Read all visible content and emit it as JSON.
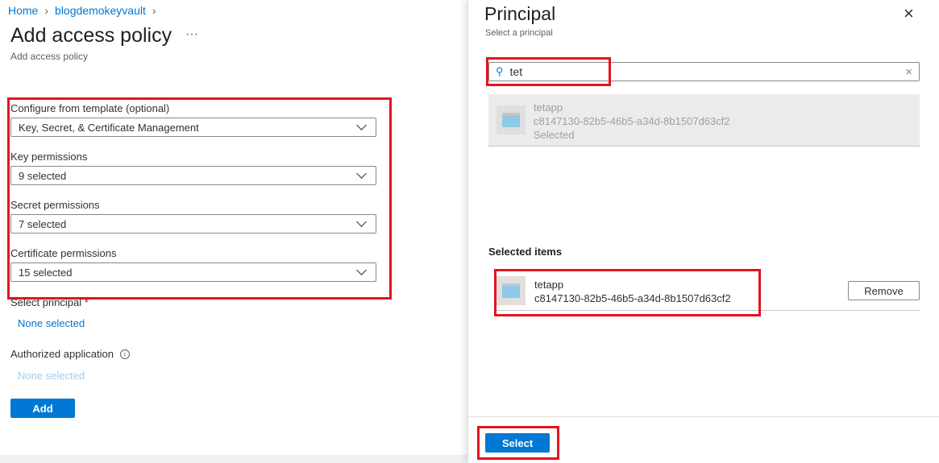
{
  "breadcrumb": {
    "home": "Home",
    "vault": "blogdemokeyvault"
  },
  "page": {
    "title": "Add access policy",
    "more": "···",
    "subtitle": "Add access policy"
  },
  "form": {
    "template": {
      "label": "Configure from template (optional)",
      "value": "Key, Secret, & Certificate Management"
    },
    "key": {
      "label": "Key permissions",
      "value": "9 selected"
    },
    "secret": {
      "label": "Secret permissions",
      "value": "7 selected"
    },
    "cert": {
      "label": "Certificate permissions",
      "value": "15 selected"
    },
    "principal": {
      "label": "Select principal",
      "required": "*",
      "value": "None selected"
    },
    "authapp": {
      "label": "Authorized application",
      "value": "None selected"
    },
    "add": "Add"
  },
  "panel": {
    "title": "Principal",
    "subtitle": "Select a principal",
    "search": {
      "value": "tet"
    },
    "result": {
      "name": "tetapp",
      "id": "c8147130-82b5-46b5-a34d-8b1507d63cf2",
      "status": "Selected"
    },
    "selected_heading": "Selected items",
    "selected_item": {
      "name": "tetapp",
      "id": "c8147130-82b5-46b5-a34d-8b1507d63cf2",
      "remove": "Remove"
    },
    "select": "Select"
  }
}
